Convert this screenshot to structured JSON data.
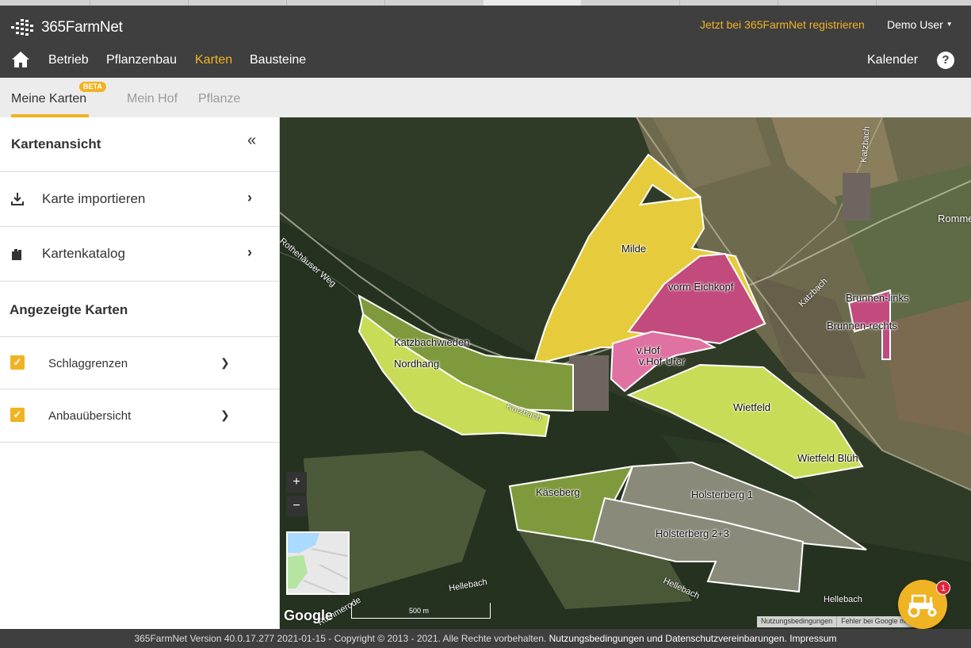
{
  "header": {
    "logo_text": "365FarmNet",
    "register_link": "Jetzt bei 365FarmNet registrieren",
    "user_name": "Demo User",
    "nav": [
      "Betrieb",
      "Pflanzenbau",
      "Karten",
      "Bausteine"
    ],
    "calendar": "Kalender",
    "help": "?"
  },
  "subtabs": {
    "items": [
      "Meine Karten",
      "Mein Hof",
      "Pflanze"
    ],
    "beta": "BETA"
  },
  "sidebar": {
    "title": "Kartenansicht",
    "collapse_icon": "double-chevron-left-icon",
    "actions": [
      {
        "label": "Karte importieren",
        "icon": "download-icon"
      },
      {
        "label": "Kartenkatalog",
        "icon": "catalog-icon"
      }
    ],
    "shown_maps_title": "Angezeigte Karten",
    "layers": [
      {
        "label": "Schlaggrenzen",
        "checked": true
      },
      {
        "label": "Anbauübersicht",
        "checked": true
      }
    ]
  },
  "map": {
    "fields": [
      "Milde",
      "vorm Eichkopf",
      "v.Hof",
      "v.Hof-Ufer",
      "Katzbachwieden",
      "Nordhang",
      "Wietfeld",
      "Wietfeld Blüh",
      "Käseberg",
      "Holsterberg 1",
      "Holsterberg 2+3",
      "Brunnen-links",
      "Brunnen-rechts"
    ],
    "streets": [
      "Rothehäuser Weg",
      "Katzbach",
      "Katzbach",
      "Katzbach",
      "Hellebach",
      "Hellebach",
      "Hellebach",
      "Rommerode"
    ],
    "zoom_in": "+",
    "zoom_out": "−",
    "google": "Google",
    "scale": "500 m",
    "terms": "Nutzungsbedingungen",
    "report": "Fehler bei Google melden",
    "notification_count": "1",
    "colors": {
      "yellow": "#e6cc3c",
      "magenta": "#c24a7d",
      "pink": "#e072a2",
      "lime": "#c8dc58",
      "olive": "#7f9a3c",
      "grey": "#8a8a7a"
    }
  },
  "footer": {
    "version": "365FarmNet Version 40.0.17.277 2021-01-15 - Copyright © 2013 - 2021. Alle Rechte vorbehalten.",
    "terms": "Nutzungsbedingungen und Datenschutzvereinbarungen.",
    "imprint": "Impressum"
  }
}
